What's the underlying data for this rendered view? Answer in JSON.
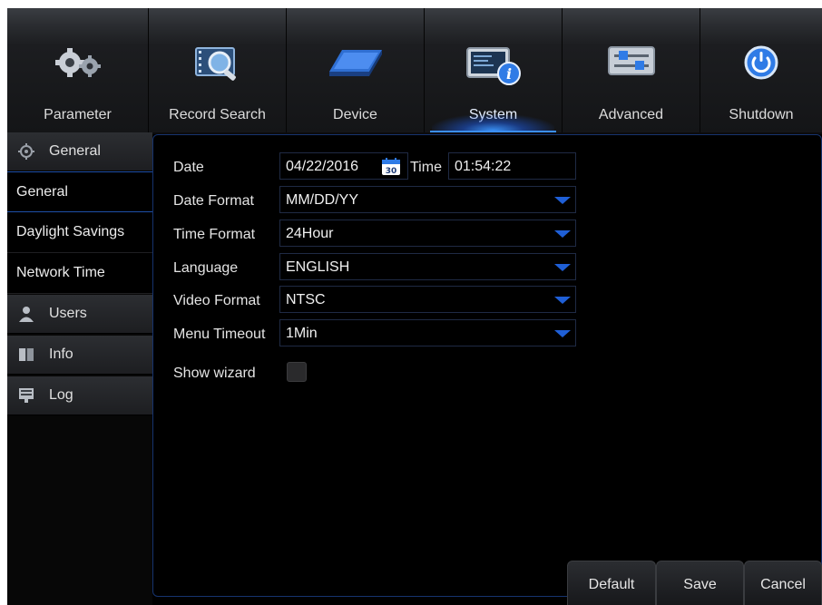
{
  "tabs": [
    {
      "label": "Parameter",
      "icon": "gears-icon"
    },
    {
      "label": "Record Search",
      "icon": "film-search-icon"
    },
    {
      "label": "Device",
      "icon": "hard-drive-icon"
    },
    {
      "label": "System",
      "icon": "monitor-info-icon"
    },
    {
      "label": "Advanced",
      "icon": "sliders-icon"
    },
    {
      "label": "Shutdown",
      "icon": "power-icon"
    }
  ],
  "active_tab": "System",
  "sidebar": {
    "general_header": "General",
    "items": [
      "General",
      "Daylight Savings",
      "Network Time"
    ],
    "active_item": "General",
    "users_header": "Users",
    "info_header": "Info",
    "log_header": "Log"
  },
  "form": {
    "date_label": "Date",
    "date_value": "04/22/2016",
    "calendar_day": "30",
    "time_label": "Time",
    "time_value": "01:54:22",
    "date_format_label": "Date Format",
    "date_format_value": "MM/DD/YY",
    "time_format_label": "Time Format",
    "time_format_value": "24Hour",
    "language_label": "Language",
    "language_value": "ENGLISH",
    "video_format_label": "Video Format",
    "video_format_value": "NTSC",
    "menu_timeout_label": "Menu Timeout",
    "menu_timeout_value": "1Min",
    "show_wizard_label": "Show wizard",
    "show_wizard_checked": false
  },
  "buttons": {
    "default": "Default",
    "save": "Save",
    "cancel": "Cancel"
  },
  "colors": {
    "accent": "#3b8fff",
    "dropdown_arrow": "#1f5fd6",
    "background": "#000000"
  }
}
